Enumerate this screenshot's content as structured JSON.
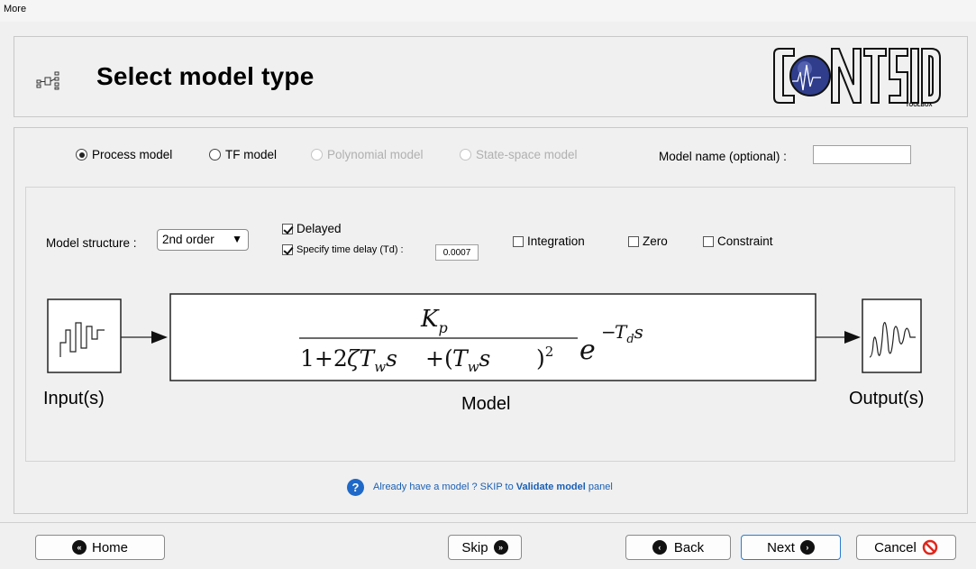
{
  "menubar": {
    "more_label": "More"
  },
  "header": {
    "title": "Select model type"
  },
  "model_types": {
    "process": "Process model",
    "tf": "TF model",
    "polynomial": "Polynomial model",
    "state_space": "State-space model",
    "selected": "Process model"
  },
  "model_name": {
    "label": "Model name (optional) :",
    "value": ""
  },
  "structure": {
    "label": "Model structure :",
    "value": "2nd order"
  },
  "options": {
    "delayed": {
      "label": "Delayed",
      "checked": true
    },
    "specify_delay": {
      "label": "Specify time delay (Td) :",
      "checked": true,
      "value": "0.0007"
    },
    "integration": {
      "label": "Integration",
      "checked": false
    },
    "zero": {
      "label": "Zero",
      "checked": false
    },
    "constraint": {
      "label": "Constraint",
      "checked": false
    }
  },
  "diagram": {
    "input_label": "Input(s)",
    "model_label": "Model",
    "output_label": "Output(s)"
  },
  "help": {
    "text_prefix": "Already have a model ? SKIP to ",
    "link": "Validate model",
    "text_suffix": " panel"
  },
  "footer": {
    "home": "Home",
    "skip": "Skip",
    "back": "Back",
    "next": "Next",
    "cancel": "Cancel"
  },
  "colors": {
    "link": "#1a5fb4",
    "help_icon": "#1f69c8",
    "cancel_icon": "#e0261b",
    "next_border": "#2a7bd4"
  }
}
